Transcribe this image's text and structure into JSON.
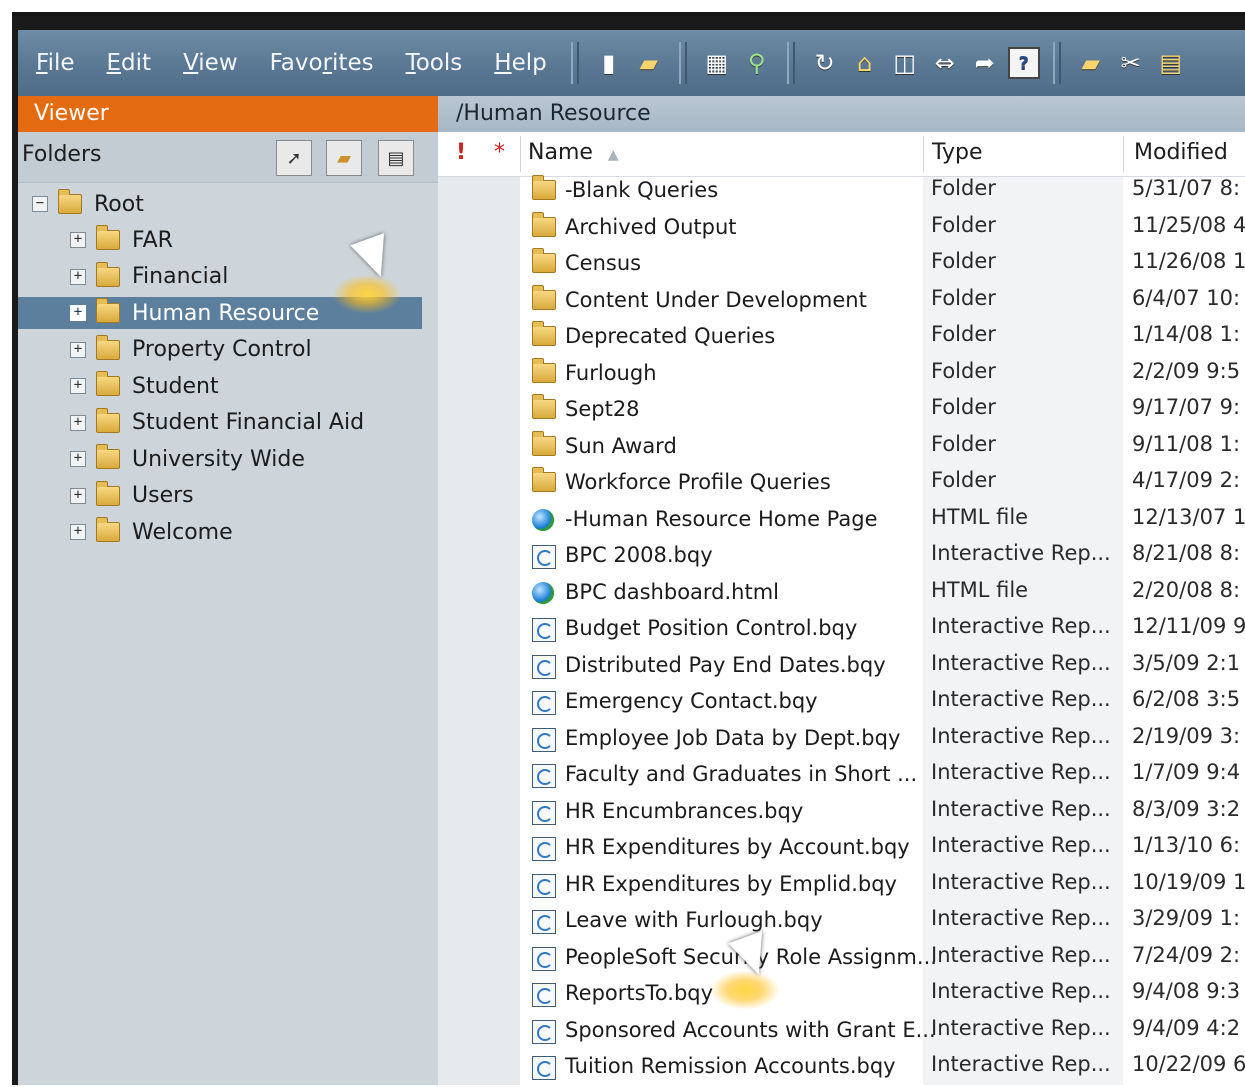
{
  "menu": {
    "items": [
      {
        "mnemonic": "F",
        "rest": "ile"
      },
      {
        "mnemonic": "E",
        "rest": "dit"
      },
      {
        "mnemonic": "V",
        "rest": "iew"
      },
      {
        "pre": "Favo",
        "mnemonic": "r",
        "rest": "ites"
      },
      {
        "mnemonic": "T",
        "rest": "ools"
      },
      {
        "mnemonic": "H",
        "rest": "elp"
      }
    ]
  },
  "toolbar": {
    "icons": [
      "new-document-icon",
      "open-folder-icon",
      "calculator-icon",
      "user-search-icon",
      "refresh-icon",
      "home-icon",
      "columns-icon",
      "fit-width-icon",
      "export-icon",
      "help-icon",
      "new-folder-icon",
      "cut-icon",
      "paste-icon"
    ],
    "help_glyph": "?"
  },
  "viewer": {
    "label": "Viewer"
  },
  "path": {
    "label": "/Human Resource"
  },
  "folders": {
    "title": "Folders",
    "root": "Root",
    "items": [
      "FAR",
      "Financial",
      "Human Resource",
      "Property Control",
      "Student",
      "Student Financial Aid",
      "University Wide",
      "Users",
      "Welcome"
    ],
    "selected_index": 2,
    "collapse_glyph": "−",
    "expand_glyph": "+"
  },
  "list": {
    "columns": {
      "flag": "!",
      "star": "*",
      "name": "Name",
      "sort_indicator": "▲",
      "type": "Type",
      "modified": "Modified"
    },
    "rows": [
      {
        "icon": "folder",
        "name": "-Blank Queries",
        "type": "Folder",
        "modified": "5/31/07 8:"
      },
      {
        "icon": "folder",
        "name": "Archived Output",
        "type": "Folder",
        "modified": "11/25/08 4"
      },
      {
        "icon": "folder",
        "name": "Census",
        "type": "Folder",
        "modified": "11/26/08 1"
      },
      {
        "icon": "folder",
        "name": "Content Under Development",
        "type": "Folder",
        "modified": "6/4/07 10:"
      },
      {
        "icon": "folder",
        "name": "Deprecated Queries",
        "type": "Folder",
        "modified": "1/14/08 1:"
      },
      {
        "icon": "folder",
        "name": "Furlough",
        "type": "Folder",
        "modified": "2/2/09 9:5"
      },
      {
        "icon": "folder",
        "name": "Sept28",
        "type": "Folder",
        "modified": "9/17/07 9:"
      },
      {
        "icon": "folder",
        "name": "Sun Award",
        "type": "Folder",
        "modified": "9/11/08 1:"
      },
      {
        "icon": "folder",
        "name": "Workforce Profile Queries",
        "type": "Folder",
        "modified": "4/17/09 2:"
      },
      {
        "icon": "html",
        "name": "-Human Resource Home Page",
        "type": "HTML file",
        "modified": "12/13/07 1"
      },
      {
        "icon": "bqy",
        "name": "BPC 2008.bqy",
        "type": "Interactive Rep...",
        "modified": "8/21/08 8:"
      },
      {
        "icon": "html",
        "name": "BPC dashboard.html",
        "type": "HTML file",
        "modified": "2/20/08 8:"
      },
      {
        "icon": "bqy",
        "name": "Budget Position Control.bqy",
        "type": "Interactive Rep...",
        "modified": "12/11/09 9"
      },
      {
        "icon": "bqy",
        "name": "Distributed Pay End Dates.bqy",
        "type": "Interactive Rep...",
        "modified": "3/5/09 2:1"
      },
      {
        "icon": "bqy",
        "name": "Emergency Contact.bqy",
        "type": "Interactive Rep...",
        "modified": "6/2/08 3:5"
      },
      {
        "icon": "bqy",
        "name": "Employee Job Data by Dept.bqy",
        "type": "Interactive Rep...",
        "modified": "2/19/09 3:"
      },
      {
        "icon": "bqy",
        "name": "Faculty and Graduates in Short ...",
        "type": "Interactive Rep...",
        "modified": "1/7/09 9:4"
      },
      {
        "icon": "bqy",
        "name": "HR Encumbrances.bqy",
        "type": "Interactive Rep...",
        "modified": "8/3/09 3:2"
      },
      {
        "icon": "bqy",
        "name": "HR Expenditures by Account.bqy",
        "type": "Interactive Rep...",
        "modified": "1/13/10 6:"
      },
      {
        "icon": "bqy",
        "name": "HR Expenditures by Emplid.bqy",
        "type": "Interactive Rep...",
        "modified": "10/19/09 1"
      },
      {
        "icon": "bqy",
        "name": "Leave with Furlough.bqy",
        "type": "Interactive Rep...",
        "modified": "3/29/09 1:"
      },
      {
        "icon": "bqy",
        "name": "PeopleSoft Security Role Assignm...",
        "type": "Interactive Rep...",
        "modified": "7/24/09 2:"
      },
      {
        "icon": "bqy",
        "name": "ReportsTo.bqy",
        "type": "Interactive Rep...",
        "modified": "9/4/08 9:3"
      },
      {
        "icon": "bqy",
        "name": "Sponsored Accounts with Grant E...",
        "type": "Interactive Rep...",
        "modified": "9/4/09 4:2"
      },
      {
        "icon": "bqy",
        "name": "Tuition Remission Accounts.bqy",
        "type": "Interactive Rep...",
        "modified": "10/22/09 6"
      }
    ]
  },
  "colors": {
    "menubar": "#5a7893",
    "viewer_tab": "#e46b12",
    "selection": "#5d7f9e",
    "folder_pane": "#cdd5db"
  }
}
